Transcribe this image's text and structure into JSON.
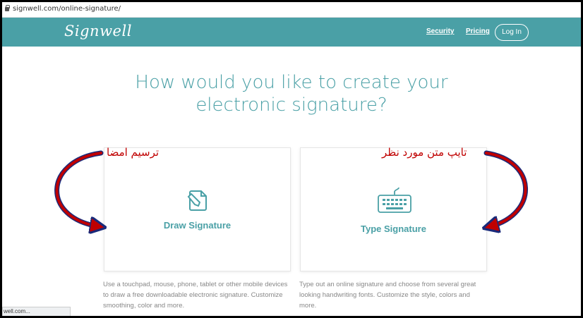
{
  "browser": {
    "url": "signwell.com/online-signature/",
    "status_text": "well.com..."
  },
  "header": {
    "logo": "Signwell",
    "nav": {
      "security": "Security",
      "pricing": "Pricing"
    },
    "login_label": "Log In",
    "bg_color": "#4aa0a6"
  },
  "main": {
    "headline_line1": "How would you like to create your",
    "headline_line2": "electronic signature?"
  },
  "cards": {
    "draw": {
      "label": "Draw Signature",
      "icon": "pen-on-paper-icon",
      "description": "Use a touchpad, mouse, phone, tablet or other mobile devices to draw a free downloadable electronic signature. Customize smoothing, color and more."
    },
    "type": {
      "label": "Type Signature",
      "icon": "keyboard-icon",
      "description": "Type out an online signature and choose from several great looking handwriting fonts. Customize the style, colors and more."
    }
  },
  "annotations": {
    "left": "ترسیم امضا",
    "right": "تایپ متن مورد نظر",
    "color": "#c00000",
    "arrow_color": "#1a2a7a"
  }
}
